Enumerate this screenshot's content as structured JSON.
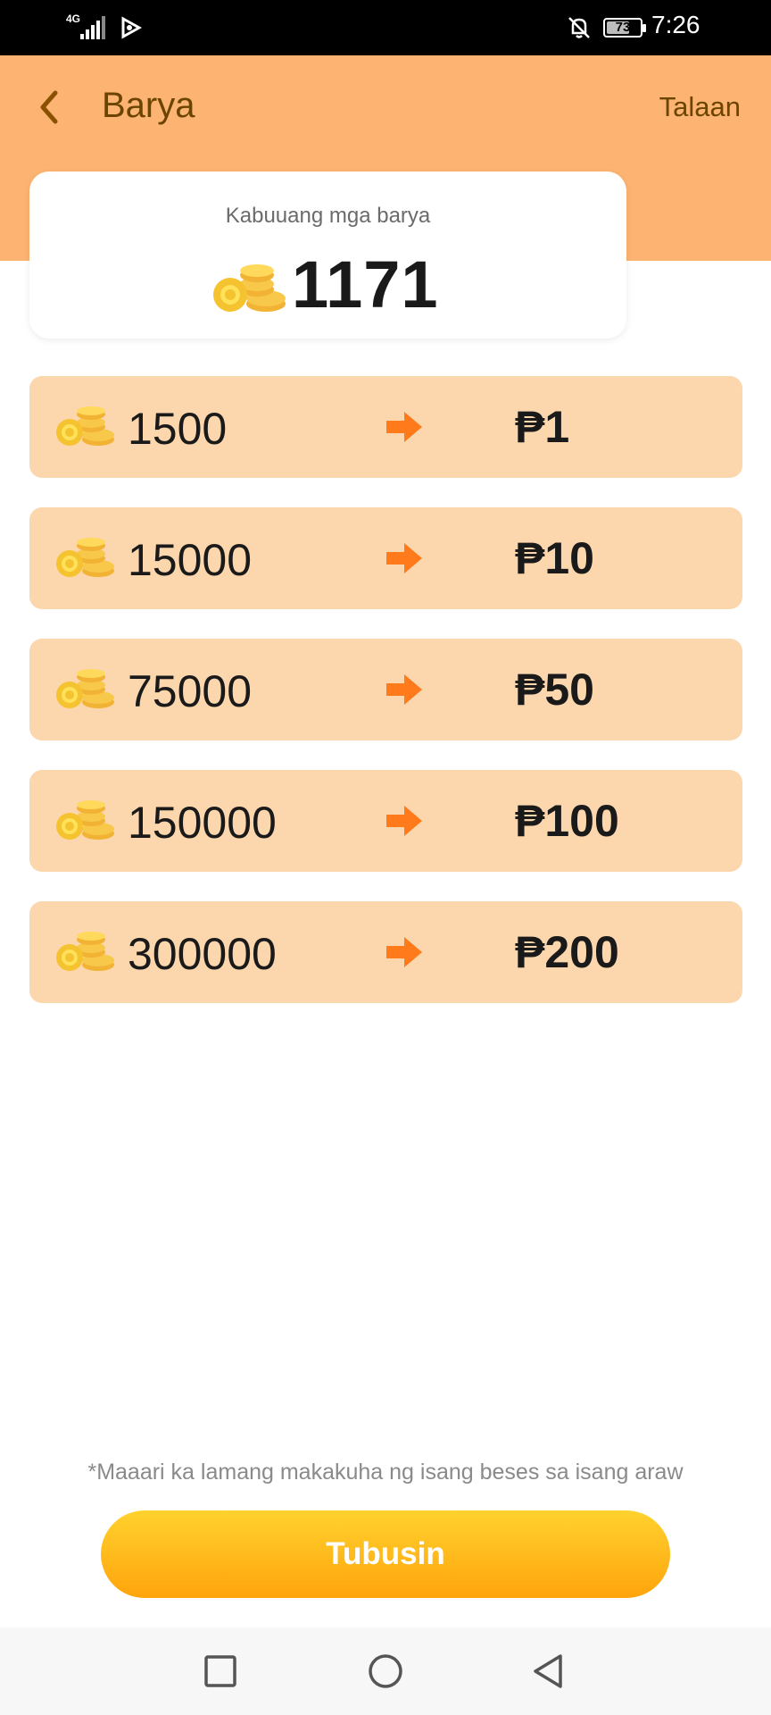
{
  "status_bar": {
    "network": "4G",
    "battery_level": 73,
    "battery_text": "73",
    "time": "7:26",
    "icons": [
      "signal-icon",
      "app-notification-icon",
      "bell-off-icon",
      "battery-icon"
    ]
  },
  "header": {
    "title": "Barya",
    "history_link": "Talaan",
    "back_icon": "chevron-left-icon",
    "background_color": "#fdb472"
  },
  "balance": {
    "label": "Kabuuang mga barya",
    "value": "1171",
    "icon": "coins-icon"
  },
  "exchange_rows": [
    {
      "coins": "1500",
      "value": "₱1"
    },
    {
      "coins": "15000",
      "value": "₱10"
    },
    {
      "coins": "75000",
      "value": "₱50"
    },
    {
      "coins": "150000",
      "value": "₱100"
    },
    {
      "coins": "300000",
      "value": "₱200"
    }
  ],
  "note": "*Maaari ka lamang makakuha ng isang beses sa isang araw",
  "redeem_button": {
    "label": "Tubusin",
    "color_top": "#ffd22e",
    "color_bottom": "#ffa40c"
  },
  "colors": {
    "row_background": "#fcd7ad",
    "arrow": "#ff7a1a",
    "text_dark": "#1a1a1a",
    "brown": "#6b4400"
  }
}
